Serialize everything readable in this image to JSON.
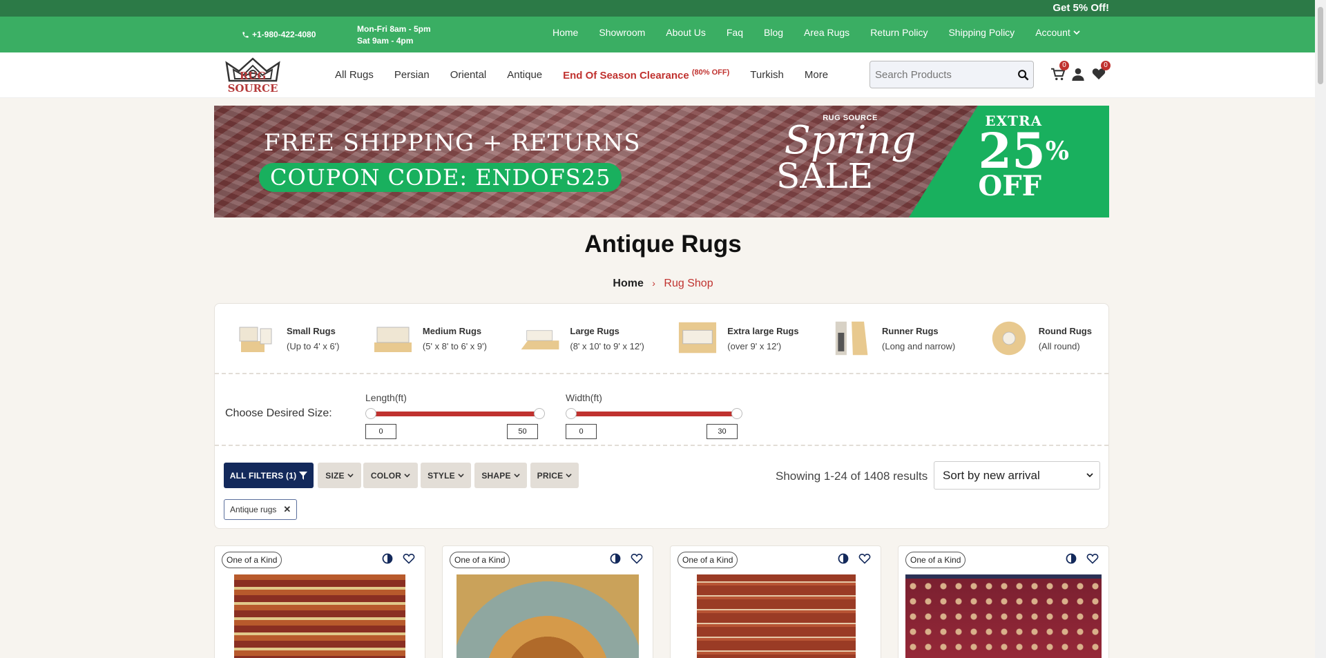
{
  "promo": {
    "text": "Get 5% Off!"
  },
  "info": {
    "phone": "+1-980-422-4080",
    "hours_1": "Mon-Fri 8am - 5pm",
    "hours_2": "Sat 9am - 4pm",
    "nav": [
      "Home",
      "Showroom",
      "About Us",
      "Faq",
      "Blog",
      "Area Rugs",
      "Return Policy",
      "Shipping Policy",
      "Account"
    ]
  },
  "header": {
    "logo_text": "RUG SOURCE",
    "nav": {
      "all": "All Rugs",
      "persian": "Persian",
      "oriental": "Oriental",
      "antique": "Antique",
      "clearance": "End Of Season Clearance",
      "clearance_sup": "(80% OFF)",
      "turkish": "Turkish",
      "more": "More"
    },
    "search_placeholder": "Search Products",
    "cart_count": "0",
    "wishlist_count": "0"
  },
  "banner": {
    "line1": "FREE SHIPPING + RETURNS",
    "coupon": "COUPON CODE: ENDOFS25",
    "brand": "RUG SOURCE",
    "script": "Spring",
    "sale": "SALE",
    "extra": "EXTRA",
    "pct": "25",
    "pct_sign": "%",
    "off": "OFF"
  },
  "page": {
    "title": "Antique Rugs",
    "breadcrumb_home": "Home",
    "breadcrumb_current": "Rug Shop"
  },
  "sizes": [
    {
      "title": "Small Rugs",
      "desc": "(Up to 4' x 6')"
    },
    {
      "title": "Medium Rugs",
      "desc": "(5' x 8' to 6' x 9')"
    },
    {
      "title": "Large Rugs",
      "desc": "(8' x 10' to 9' x 12')"
    },
    {
      "title": "Extra large Rugs",
      "desc": "(over 9' x 12')"
    },
    {
      "title": "Runner Rugs",
      "desc": "(Long and narrow)"
    },
    {
      "title": "Round Rugs",
      "desc": "(All round)"
    }
  ],
  "size_filter": {
    "label": "Choose Desired Size:",
    "length_label": "Length(ft)",
    "length_min": "0",
    "length_max": "50",
    "width_label": "Width(ft)",
    "width_min": "0",
    "width_max": "30"
  },
  "filters": {
    "all": "ALL FILTERS (1)",
    "size": "SIZE",
    "color": "COLOR",
    "style": "STYLE",
    "shape": "SHAPE",
    "price": "PRICE",
    "results": "Showing 1-24 of 1408 results",
    "sort": "Sort by new arrival",
    "active_chip": "Antique rugs"
  },
  "products": [
    {
      "tag": "One of a Kind"
    },
    {
      "tag": "One of a Kind"
    },
    {
      "tag": "One of a Kind"
    },
    {
      "tag": "One of a Kind"
    }
  ],
  "colors": {
    "brand_red": "#c0322f",
    "green": "#3aae63",
    "navy": "#13295b"
  }
}
